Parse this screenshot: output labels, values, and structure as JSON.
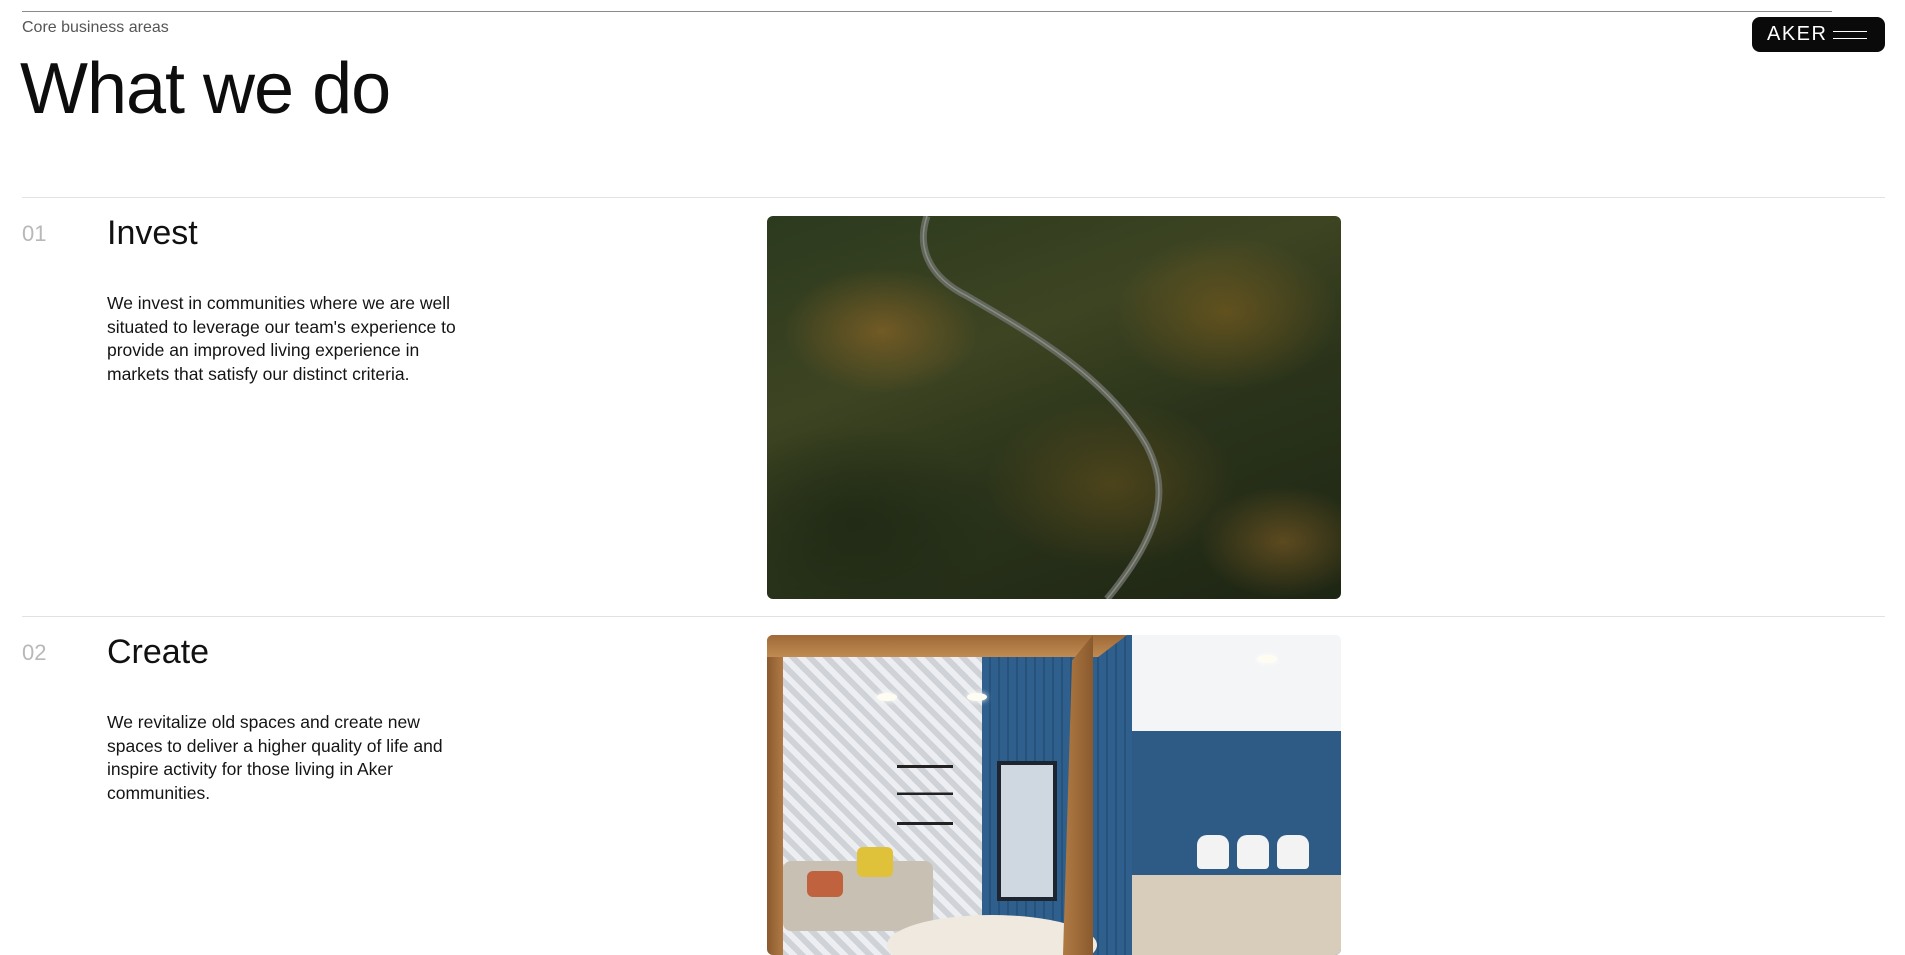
{
  "header": {
    "eyebrow": "Core business areas",
    "title": "What we do"
  },
  "brand": {
    "label": "AKER",
    "menu_icon": "hamburger-menu-icon",
    "background": "#0a0a0a"
  },
  "sections": [
    {
      "number": "01",
      "title": "Invest",
      "body": "We invest in communities where we are well situated to leverage our team's experience to provide an improved living experience in markets that satisfy our distinct criteria.",
      "image": "aerial-forest-road-photo"
    },
    {
      "number": "02",
      "title": "Create",
      "body": "We revitalize old spaces and create new spaces to deliver a higher quality of life and inspire activity for those living in Aker communities.",
      "image": "interior-lounge-photo"
    }
  ]
}
